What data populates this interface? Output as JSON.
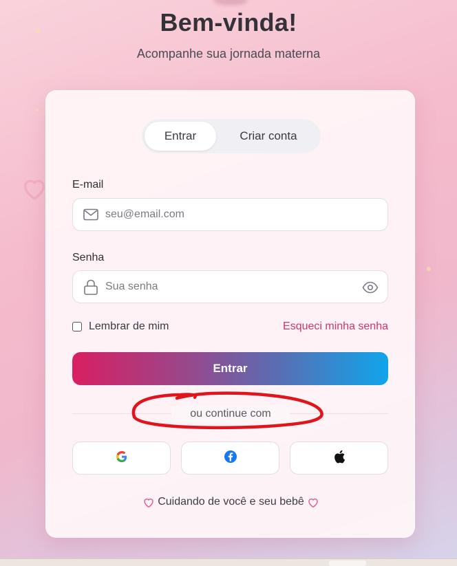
{
  "header": {
    "title": "Bem-vinda!",
    "subtitle": "Acompanhe sua jornada materna"
  },
  "tabs": [
    {
      "label": "Entrar",
      "active": true
    },
    {
      "label": "Criar conta",
      "active": false
    }
  ],
  "form": {
    "email": {
      "label": "E-mail",
      "placeholder": "seu@email.com",
      "value": "",
      "icon": "mail-icon"
    },
    "password": {
      "label": "Senha",
      "placeholder": "Sua senha",
      "value": "",
      "icon": "lock-icon",
      "toggle_icon": "eye-icon"
    },
    "remember_label": "Lembrar de mim",
    "remember_checked": false,
    "forgot_label": "Esqueci minha senha",
    "submit_label": "Entrar"
  },
  "social": {
    "divider_text": "ou continue com",
    "providers": [
      {
        "name": "google",
        "icon": "google-icon"
      },
      {
        "name": "facebook",
        "icon": "facebook-icon"
      },
      {
        "name": "apple",
        "icon": "apple-icon"
      }
    ]
  },
  "footer": {
    "text": "Cuidando de você e seu bebê",
    "icon": "heart-icon"
  },
  "colors": {
    "accent_pink": "#d0346f",
    "gradient_start": "#d81f62",
    "gradient_end": "#10a5ea",
    "annotation_red": "#e0141b"
  }
}
